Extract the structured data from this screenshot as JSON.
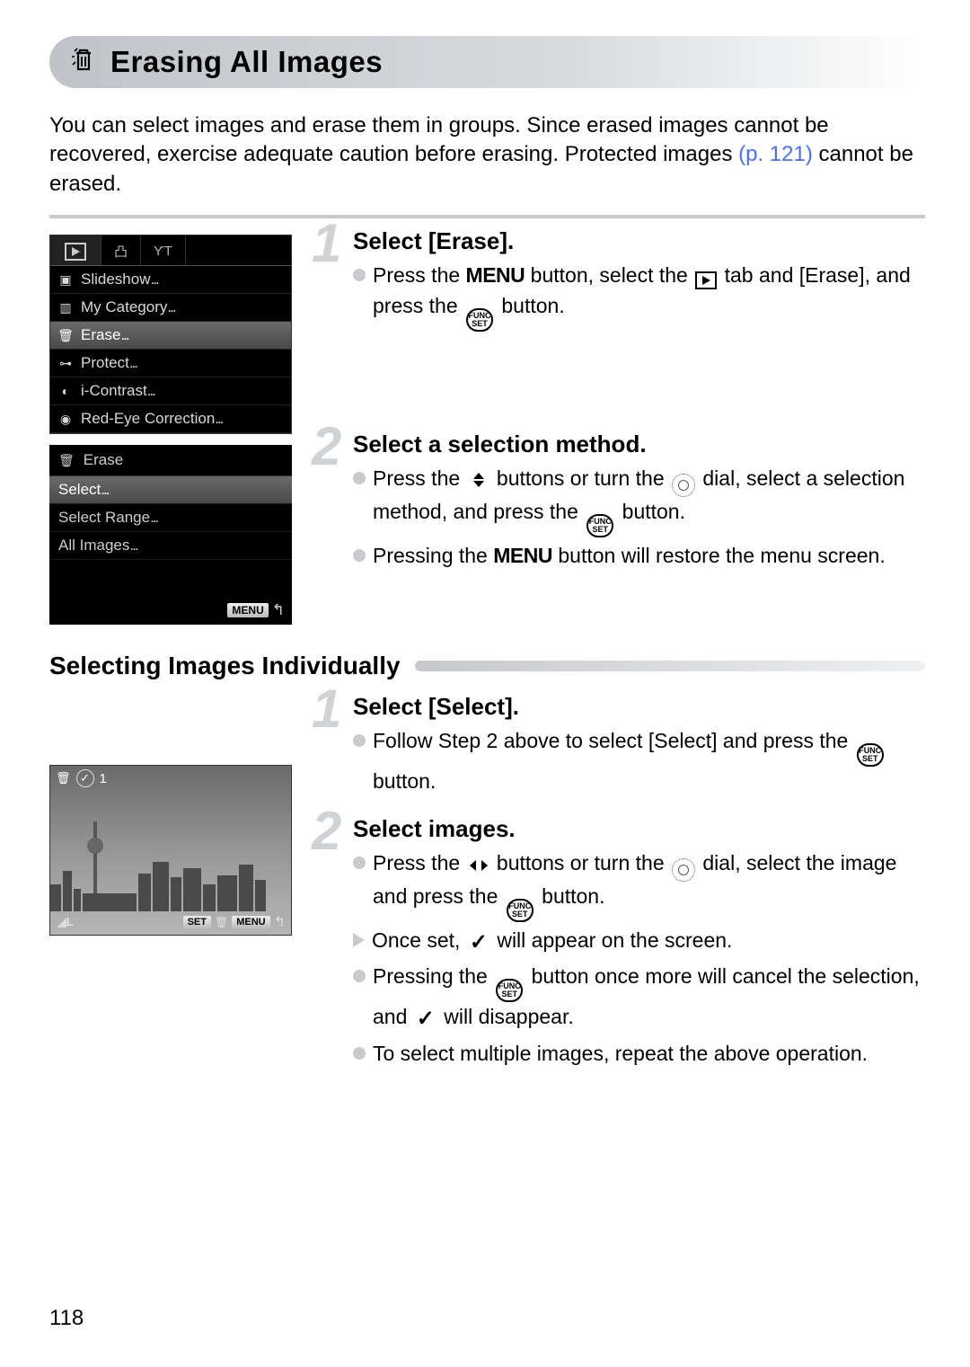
{
  "title": "Erasing All Images",
  "intro_a": "You can select images and erase them in groups. Since erased images cannot be recovered, exercise adequate caution before erasing. Protected images ",
  "intro_link": "(p. 121)",
  "intro_b": " cannot be erased.",
  "menu": {
    "items": [
      {
        "icon": "slideshow",
        "label": "Slideshow"
      },
      {
        "icon": "category",
        "label": "My Category"
      },
      {
        "icon": "erase",
        "label": "Erase"
      },
      {
        "icon": "protect",
        "label": "Protect"
      },
      {
        "icon": "contrast",
        "label": "i-Contrast"
      },
      {
        "icon": "redeye",
        "label": "Red-Eye Correction"
      }
    ],
    "selected": 2
  },
  "erase_sub": {
    "title": "Erase",
    "items": [
      "Select",
      "Select Range",
      "All Images"
    ],
    "selected": 0,
    "menu_badge": "MENU"
  },
  "step1": {
    "num": "1",
    "title": "Select [Erase].",
    "b1a": "Press the ",
    "b1_menu": "MENU",
    "b1b": " button, select the ",
    "b1c": " tab and [Erase], and press the ",
    "b1d": " button."
  },
  "step2": {
    "num": "2",
    "title": "Select a selection method.",
    "b1a": "Press the ",
    "b1b": " buttons or turn the ",
    "b1c": " dial, select a selection method, and press the ",
    "b1d": " button.",
    "b2a": "Pressing the ",
    "b2_menu": "MENU",
    "b2b": " button will restore the menu screen."
  },
  "sub_heading": "Selecting Images Individually",
  "stepA": {
    "num": "1",
    "title": "Select [Select].",
    "b1a": "Follow Step 2 above to select [Select] and press the ",
    "b1b": " button."
  },
  "stepB": {
    "num": "2",
    "title": "Select images.",
    "b1a": "Press the ",
    "b1b": " buttons or turn the ",
    "b1c": " dial, select the image and press the ",
    "b1d": " button.",
    "b2a": "Once set, ",
    "b2b": " will appear on the screen.",
    "b3a": "Pressing the ",
    "b3b": " button once more will cancel the selection, and ",
    "b3c": " will disappear.",
    "b4": "To select multiple images, repeat the above operation."
  },
  "preview": {
    "count": "1",
    "set": "SET",
    "menu": "MENU",
    "bl": "◢L"
  },
  "page": "118",
  "func_top": "FUNC",
  "func_bot": "SET"
}
